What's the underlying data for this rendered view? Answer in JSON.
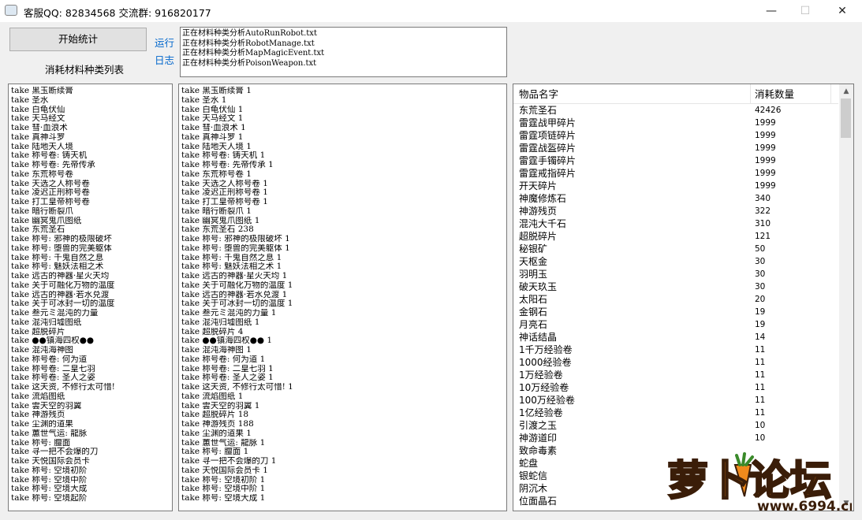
{
  "window": {
    "title": "客服QQ:  82834568      交流群:  916820177",
    "minimize_glyph": "—",
    "maximize_glyph": "☐",
    "close_glyph": "✕"
  },
  "controls": {
    "start_button": "开始统计",
    "run_log_line1": "运行",
    "run_log_line2": "日志",
    "list_caption": "消耗材料种类列表"
  },
  "log": [
    "正在材料种类分析AutoRunRobot.txt",
    "正在材料种类分析RobotManage.txt",
    "正在材料种类分析MapMagicEvent.txt",
    "正在材料种类分析PoisonWeapon.txt"
  ],
  "types_list": [
    "take 黑玉断续膏",
    "take 圣水",
    "take 白龟伏仙",
    "take 天马经文",
    "take 彗·血浪术",
    "take 真神斗罗",
    "take 陆地天人境",
    "take 称号卷: 铸天机",
    "take 称号卷: 先帝传承",
    "take 东荒称号卷",
    "take 天选之人称号卷",
    "take 凌迟正刑称号卷",
    "take 打工皇帝称号卷",
    "take 暗行断裂爪",
    "take 幽冥鬼爪图纸",
    "take 东荒圣石",
    "take 称号: 邪神的极限破坏",
    "take 称号: 堕兽的完美躯体",
    "take 称号: 千鬼自然之息",
    "take 称号: 魅妖法相之术",
    "take 远古的神器·星火天均",
    "take 关于可融化万物的温度",
    "take 远古的神器·若水兑渡",
    "take 关于可冰封一切的温度",
    "take 叁元ミ混沌的力量",
    "take 混沌归墟图纸",
    "take 超脱碎片",
    "take ●●镇海四权●●",
    "take 混沌海神图",
    "take 称号卷: 何为道",
    "take 称号卷: 二皇七羽",
    "take 称号卷: 圣人之姿",
    "take 这天资, 不修行太可惜!",
    "take 流焰图纸",
    "take 雲天空的羽翼",
    "take 神游残页",
    "take 尘渊的道果",
    "take 蕙世气运: 龍脉",
    "take 称号: 膻面",
    "take 寻一把不会爆的刀",
    "take 天悦国际会员卡",
    "take 称号: 空境初阶",
    "take 称号: 空境中阶",
    "take 称号: 空境大成",
    "take 称号: 空境起阶"
  ],
  "counts_list": [
    "take 黑玉断续膏 1",
    "take 圣水 1",
    "take 白龟伏仙 1",
    "take 天马经文 1",
    "take 彗·血浪术 1",
    "take 真神斗罗 1",
    "take 陆地天人境 1",
    "take 称号卷: 铸天机 1",
    "take 称号卷: 先帝传承 1",
    "take 东荒称号卷 1",
    "take 天选之人称号卷 1",
    "take 凌迟正刑称号卷 1",
    "take 打工皇帝称号卷 1",
    "take 暗行断裂爪 1",
    "take 幽冥鬼爪图纸 1",
    "take 东荒圣石 238",
    "take 称号: 邪神的极限破坏 1",
    "take 称号: 堕兽的完美躯体 1",
    "take 称号: 千鬼自然之息 1",
    "take 称号: 魅妖法相之术 1",
    "take 远古的神器·星火天均 1",
    "take 关于可融化万物的温度 1",
    "take 远古的神器·若水兑渡 1",
    "take 关于可冰封一切的温度 1",
    "take 叁元ミ混沌的力量 1",
    "take 混沌归墟图纸 1",
    "take 超脱碎片 4",
    "take ●●镇海四权●● 1",
    "take 混沌海神图 1",
    "take 称号卷: 何为道 1",
    "take 称号卷: 二皇七羽 1",
    "take 称号卷: 圣人之姿 1",
    "take 这天资, 不修行太可惜! 1",
    "take 流焰图纸 1",
    "take 雲天空的羽翼 1",
    "take 超脱碎片 18",
    "take 神游残页 188",
    "take 尘渊的道果 1",
    "take 蕙世气运: 龍脉 1",
    "take 称号: 膻面 1",
    "take 寻一把不会爆的刀 1",
    "take 天悦国际会员卡 1",
    "take 称号: 空境初阶 1",
    "take 称号: 空境中阶 1",
    "take 称号: 空境大成 1"
  ],
  "table": {
    "col_name": "物品名字",
    "col_count": "消耗数量",
    "rows": [
      {
        "name": "东荒圣石",
        "count": "42426"
      },
      {
        "name": "雷霆战甲碎片",
        "count": "1999"
      },
      {
        "name": "雷霆项链碎片",
        "count": "1999"
      },
      {
        "name": "雷霆战盔碎片",
        "count": "1999"
      },
      {
        "name": "雷霆手镯碎片",
        "count": "1999"
      },
      {
        "name": "雷霆戒指碎片",
        "count": "1999"
      },
      {
        "name": "开天碎片",
        "count": "1999"
      },
      {
        "name": "神魔修炼石",
        "count": "340"
      },
      {
        "name": "神游残页",
        "count": "322"
      },
      {
        "name": "混沌大千石",
        "count": "310"
      },
      {
        "name": "超脱碎片",
        "count": "121"
      },
      {
        "name": "秘银矿",
        "count": "50"
      },
      {
        "name": "天枢金",
        "count": "30"
      },
      {
        "name": "羽明玉",
        "count": "30"
      },
      {
        "name": "破天玖玉",
        "count": "30"
      },
      {
        "name": "太阳石",
        "count": "20"
      },
      {
        "name": "金钢石",
        "count": "19"
      },
      {
        "name": "月亮石",
        "count": "19"
      },
      {
        "name": "神话结晶",
        "count": "14"
      },
      {
        "name": "1千万经验卷",
        "count": "11"
      },
      {
        "name": "1000经验卷",
        "count": "11"
      },
      {
        "name": "1万经验卷",
        "count": "11"
      },
      {
        "name": "10万经验卷",
        "count": "11"
      },
      {
        "name": "100万经验卷",
        "count": "11"
      },
      {
        "name": "1亿经验卷",
        "count": "11"
      },
      {
        "name": "引渡之玉",
        "count": "10"
      },
      {
        "name": "神游道印",
        "count": "10"
      },
      {
        "name": "致命毒素",
        "count": ""
      },
      {
        "name": "蛇盘",
        "count": ""
      },
      {
        "name": "银蛇信",
        "count": ""
      },
      {
        "name": "阴沉木",
        "count": ""
      },
      {
        "name": "位面晶石",
        "count": ""
      }
    ]
  },
  "watermark": {
    "brand": "萝卜论坛",
    "domain": "www.6994.cn"
  },
  "colors": {
    "link": "#0066cc",
    "watermark_orange": "#f08a1c",
    "watermark_dark": "#3a1d08"
  }
}
